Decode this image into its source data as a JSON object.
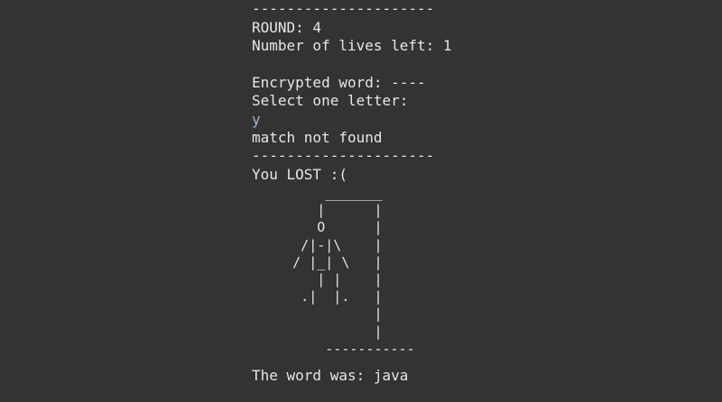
{
  "console": {
    "separator_top": "---------------------",
    "round": "ROUND: 4",
    "lives": "Number of lives left: 1",
    "encrypted": "Encrypted word: ----",
    "prompt": "Select one letter:",
    "user_input": "y",
    "result": "match not found",
    "separator_mid": "---------------------",
    "lost": "You LOST :(",
    "hangman_art": "         _______\n        |      |\n        O      |\n      /|-|\\    |\n     / |_| \\   |\n        | |    |\n      .|  |.   |\n               |\n               |\n         -----------",
    "word_reveal": "The word was: java"
  },
  "colors": {
    "background": "#333333",
    "text": "#e6e6e6",
    "input_text": "#9fb4d8"
  }
}
